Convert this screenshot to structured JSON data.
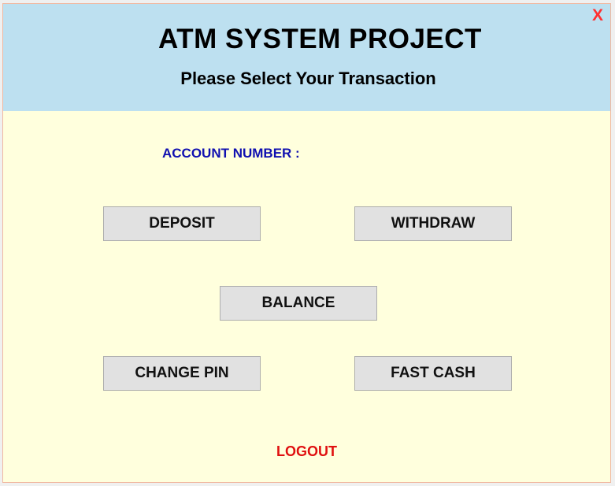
{
  "window": {
    "close_label": "X"
  },
  "header": {
    "title": "ATM SYSTEM PROJECT",
    "subtitle": "Please Select Your Transaction"
  },
  "account": {
    "label": "ACCOUNT NUMBER :",
    "value": ""
  },
  "buttons": {
    "deposit": "DEPOSIT",
    "withdraw": "WITHDRAW",
    "balance": "BALANCE",
    "change_pin": "CHANGE PIN",
    "fast_cash": "FAST CASH"
  },
  "footer": {
    "logout": "LOGOUT"
  },
  "colors": {
    "header_bg": "#bde0f0",
    "body_bg": "#ffffdd",
    "account_label": "#1010b0",
    "logout": "#e01010",
    "close": "#ff3030"
  }
}
